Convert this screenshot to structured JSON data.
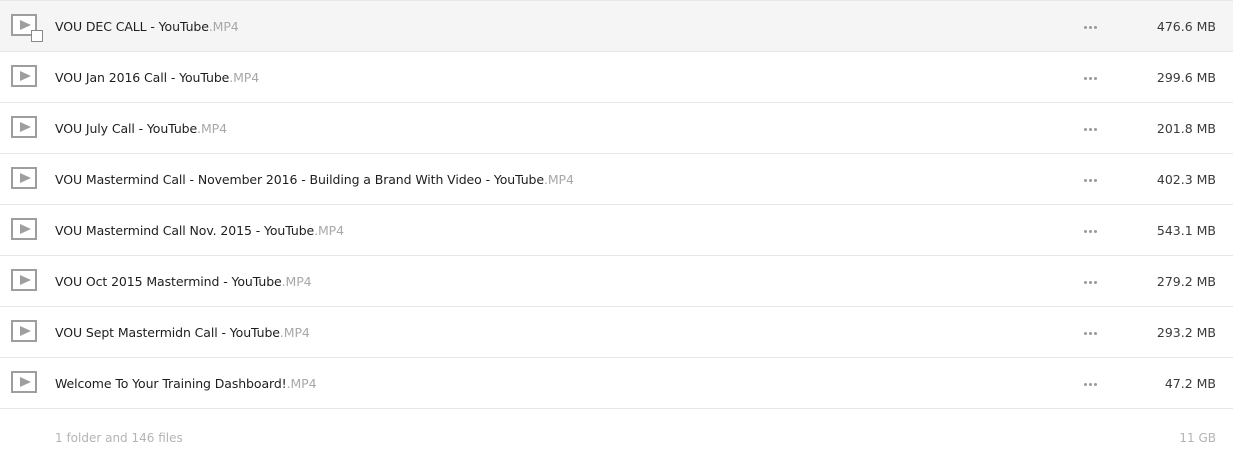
{
  "files": [
    {
      "base": "VOU DEC CALL - YouTube",
      "ext": ".MP4",
      "size": "476.6 MB",
      "icon": "video-file-icon",
      "selected": true
    },
    {
      "base": "VOU Jan 2016 Call - YouTube",
      "ext": ".MP4",
      "size": "299.6 MB",
      "icon": "video-file-icon",
      "selected": false
    },
    {
      "base": "VOU July Call - YouTube",
      "ext": ".MP4",
      "size": "201.8 MB",
      "icon": "video-file-icon",
      "selected": false
    },
    {
      "base": "VOU Mastermind Call - November 2016 - Building a Brand With Video - YouTube",
      "ext": ".MP4",
      "size": "402.3 MB",
      "icon": "video-file-icon",
      "selected": false
    },
    {
      "base": "VOU Mastermind Call Nov. 2015 - YouTube",
      "ext": ".MP4",
      "size": "543.1 MB",
      "icon": "video-file-icon",
      "selected": false
    },
    {
      "base": "VOU Oct 2015 Mastermind - YouTube",
      "ext": ".MP4",
      "size": "279.2 MB",
      "icon": "video-file-icon",
      "selected": false
    },
    {
      "base": "VOU Sept Mastermidn Call - YouTube",
      "ext": ".MP4",
      "size": "293.2 MB",
      "icon": "video-file-icon",
      "selected": false
    },
    {
      "base": "Welcome To Your Training Dashboard!",
      "ext": ".MP4",
      "size": "47.2 MB",
      "icon": "video-file-icon",
      "selected": false
    }
  ],
  "footer": {
    "summary": "1 folder and 146 files",
    "total_size": "11 GB"
  },
  "colors": {
    "selected_row_bg": "#f5f5f5",
    "extension_text": "#a8a8a8",
    "divider": "#e6e6e6"
  }
}
